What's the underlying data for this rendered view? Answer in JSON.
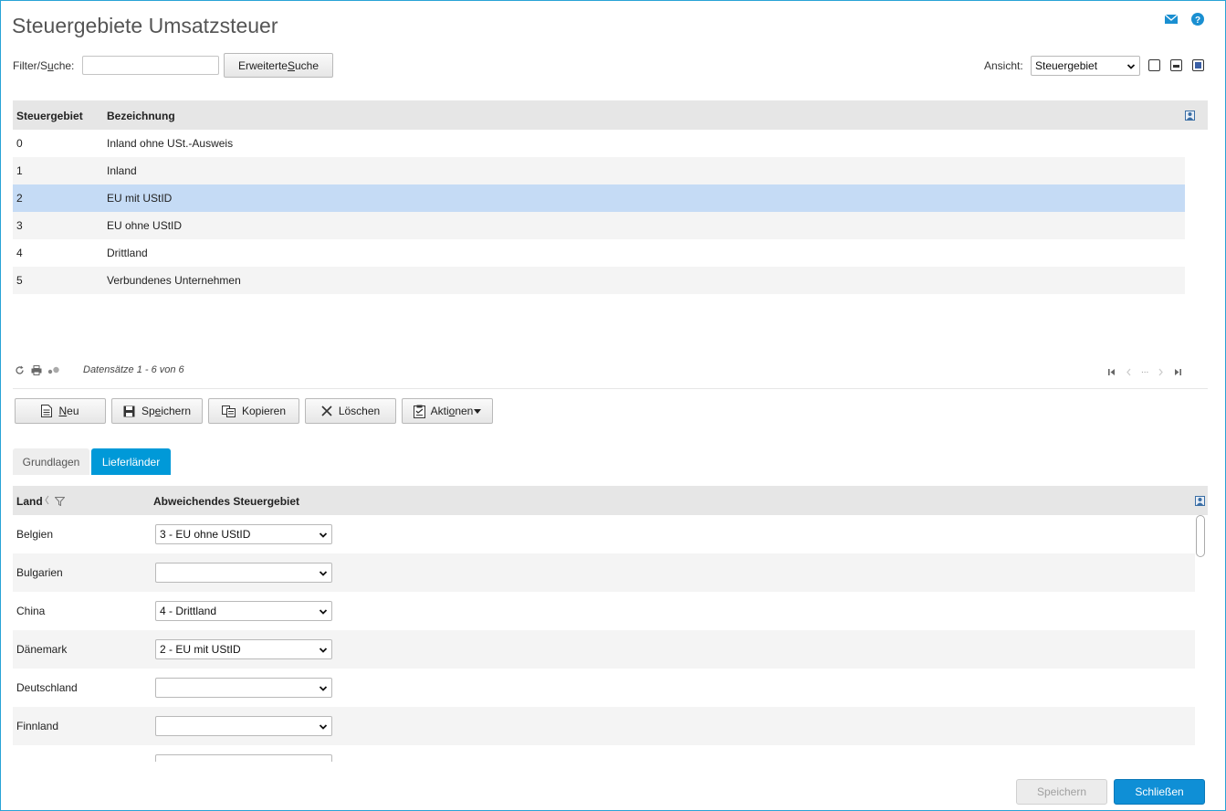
{
  "page": {
    "title": "Steuergebiete Umsatzsteuer",
    "top_icons": [
      "mail-icon",
      "help-icon"
    ]
  },
  "filter": {
    "label_prefix": "Filter/S",
    "label_underlined": "u",
    "label_suffix": "che:",
    "value": "",
    "extended_search_prefix": "Erweiterte ",
    "extended_search_underlined": "S",
    "extended_search_suffix": "uche"
  },
  "view": {
    "label": "Ansicht:",
    "selected": "Steuergebiet",
    "layout_icons": [
      "layout-single-icon",
      "layout-split-icon",
      "layout-full-icon"
    ]
  },
  "main_table": {
    "columns": [
      "Steuergebiet",
      "Bezeichnung"
    ],
    "rows": [
      {
        "code": "0",
        "name": "Inland ohne USt.-Ausweis"
      },
      {
        "code": "1",
        "name": "Inland"
      },
      {
        "code": "2",
        "name": "EU mit UStID"
      },
      {
        "code": "3",
        "name": "EU ohne UStID"
      },
      {
        "code": "4",
        "name": "Drittland"
      },
      {
        "code": "5",
        "name": "Verbundenes Unternehmen"
      }
    ],
    "selected_index": 2,
    "records_text": "Datensätze 1 - 6 von 6",
    "pager_ellipsis": "..."
  },
  "toolbar": {
    "new_underlined": "N",
    "new_rest": "eu",
    "save_prefix": "Sp",
    "save_underlined": "e",
    "save_suffix": "ichern",
    "copy_label": "Kopieren",
    "delete_label": "Löschen",
    "actions_prefix": "Akti",
    "actions_underlined": "o",
    "actions_suffix": "nen"
  },
  "tabs": [
    {
      "label": "Grundlagen",
      "active": false
    },
    {
      "label": "Lieferländer",
      "active": true
    }
  ],
  "countries_table": {
    "columns": [
      "Land",
      "Abweichendes Steuergebiet"
    ],
    "rows": [
      {
        "land": "Belgien",
        "steuergebiet": "3 - EU ohne UStID"
      },
      {
        "land": "Bulgarien",
        "steuergebiet": ""
      },
      {
        "land": "China",
        "steuergebiet": "4 - Drittland"
      },
      {
        "land": "Dänemark",
        "steuergebiet": "2 - EU mit UStID"
      },
      {
        "land": "Deutschland",
        "steuergebiet": ""
      },
      {
        "land": "Finnland",
        "steuergebiet": ""
      }
    ]
  },
  "footer": {
    "save_label": "Speichern",
    "close_label": "Schließen"
  },
  "colors": {
    "accent": "#0099d8",
    "selected_row": "#c5dbf5",
    "header_bg": "#e6e6e6",
    "alt_row": "#f4f4f4"
  }
}
